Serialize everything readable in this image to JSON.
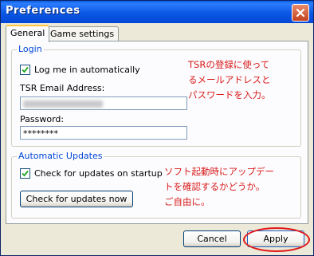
{
  "window": {
    "title": "Preferences"
  },
  "tabs": [
    {
      "label": "General",
      "active": true
    },
    {
      "label": "Game settings",
      "active": false
    }
  ],
  "login": {
    "legend": "Login",
    "auto_login_label": "Log me in automatically",
    "auto_login_checked": true,
    "email_label": "TSR Email Address:",
    "password_label": "Password:",
    "password_value": "********"
  },
  "updates": {
    "legend": "Automatic Updates",
    "check_label": "Check for updates on startup",
    "check_checked": true,
    "check_now_button": "Check for updates now"
  },
  "footer": {
    "cancel": "Cancel",
    "apply": "Apply"
  },
  "annotations": {
    "login_note": "TSRの登録に使って\nるメールアドレスと\nパスワードを入力。",
    "update_note": "ソフト起動時にアップデー\nトを確認するかどうか。\nご自由に。"
  },
  "colors": {
    "annotation": "#d81a1a",
    "legend": "#0046d5",
    "title_bar": "#0b58e3"
  }
}
